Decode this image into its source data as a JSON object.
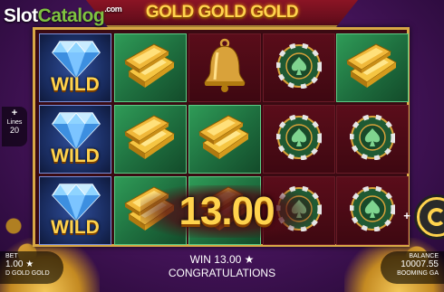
{
  "watermark": {
    "slot": "Slot",
    "catalog": "Catalog",
    "com": ".com"
  },
  "title": "GOLD GOLD GOLD",
  "reels": [
    [
      "wild",
      "wild",
      "wild"
    ],
    [
      "gold-bar",
      "gold-bar",
      "gold-bar"
    ],
    [
      "bell",
      "gold-bar",
      "gold-bar"
    ],
    [
      "chip",
      "chip",
      "chip"
    ],
    [
      "gold-bar",
      "chip",
      "chip"
    ]
  ],
  "wild_label": "WILD",
  "win_amount": "13.00",
  "lines": {
    "plus": "+",
    "label": "Lines",
    "value": "20"
  },
  "bet": {
    "label": "BET",
    "value": "1.00 ★",
    "game_name": "D GOLD GOLD"
  },
  "center": {
    "win": "WIN 13.00 ★",
    "message": "CONGRATULATIONS"
  },
  "balance": {
    "label": "BALANCE",
    "value": "10007.55",
    "provider": "BOOMING GA"
  },
  "colors": {
    "gold": "#ffd34d",
    "frame": "#d8a845",
    "green": "#2f9b57",
    "purple": "#4a1660"
  }
}
